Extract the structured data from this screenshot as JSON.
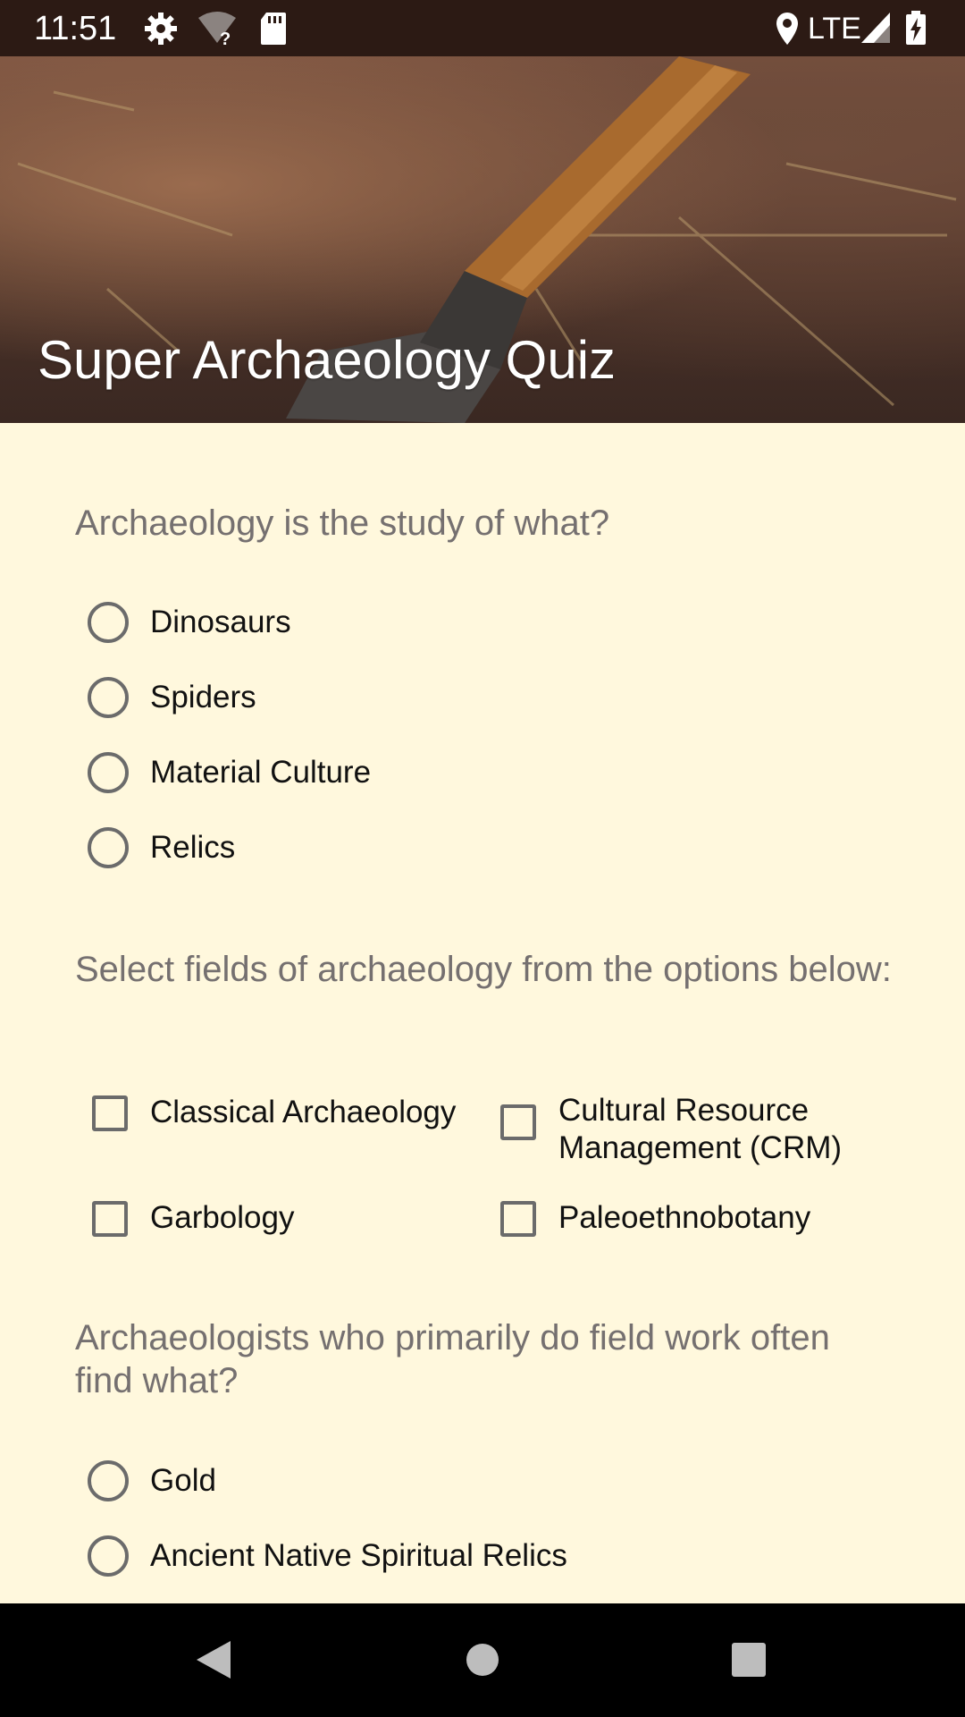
{
  "status_bar": {
    "time": "11:51",
    "network": "LTE",
    "icons": [
      "gear-icon",
      "wifi-unknown-icon",
      "sd-card-icon",
      "location-icon",
      "signal-icon",
      "battery-charging-icon"
    ]
  },
  "header": {
    "title": "Super Archaeology Quiz"
  },
  "questions": [
    {
      "text": "Archaeology is the study of what?",
      "type": "radio",
      "options": [
        "Dinosaurs",
        "Spiders",
        "Material Culture",
        "Relics"
      ]
    },
    {
      "text": "Select fields of archaeology from the options below:",
      "type": "checkbox",
      "options": [
        "Classical Archaeology",
        "Cultural Resource Management (CRM)",
        "Garbology",
        "Paleoethnobotany"
      ]
    },
    {
      "text": "Archaeologists who primarily do field work often find what?",
      "type": "radio",
      "options": [
        "Gold",
        "Ancient Native Spiritual Relics"
      ]
    }
  ],
  "nav_bar": {
    "icons": [
      "back-icon",
      "home-icon",
      "recents-icon"
    ]
  },
  "colors": {
    "background": "#fff8dd",
    "status_bar": "#2c1a14",
    "question_text": "#757070",
    "option_text": "#111111",
    "control_border": "#6b6b6b"
  }
}
